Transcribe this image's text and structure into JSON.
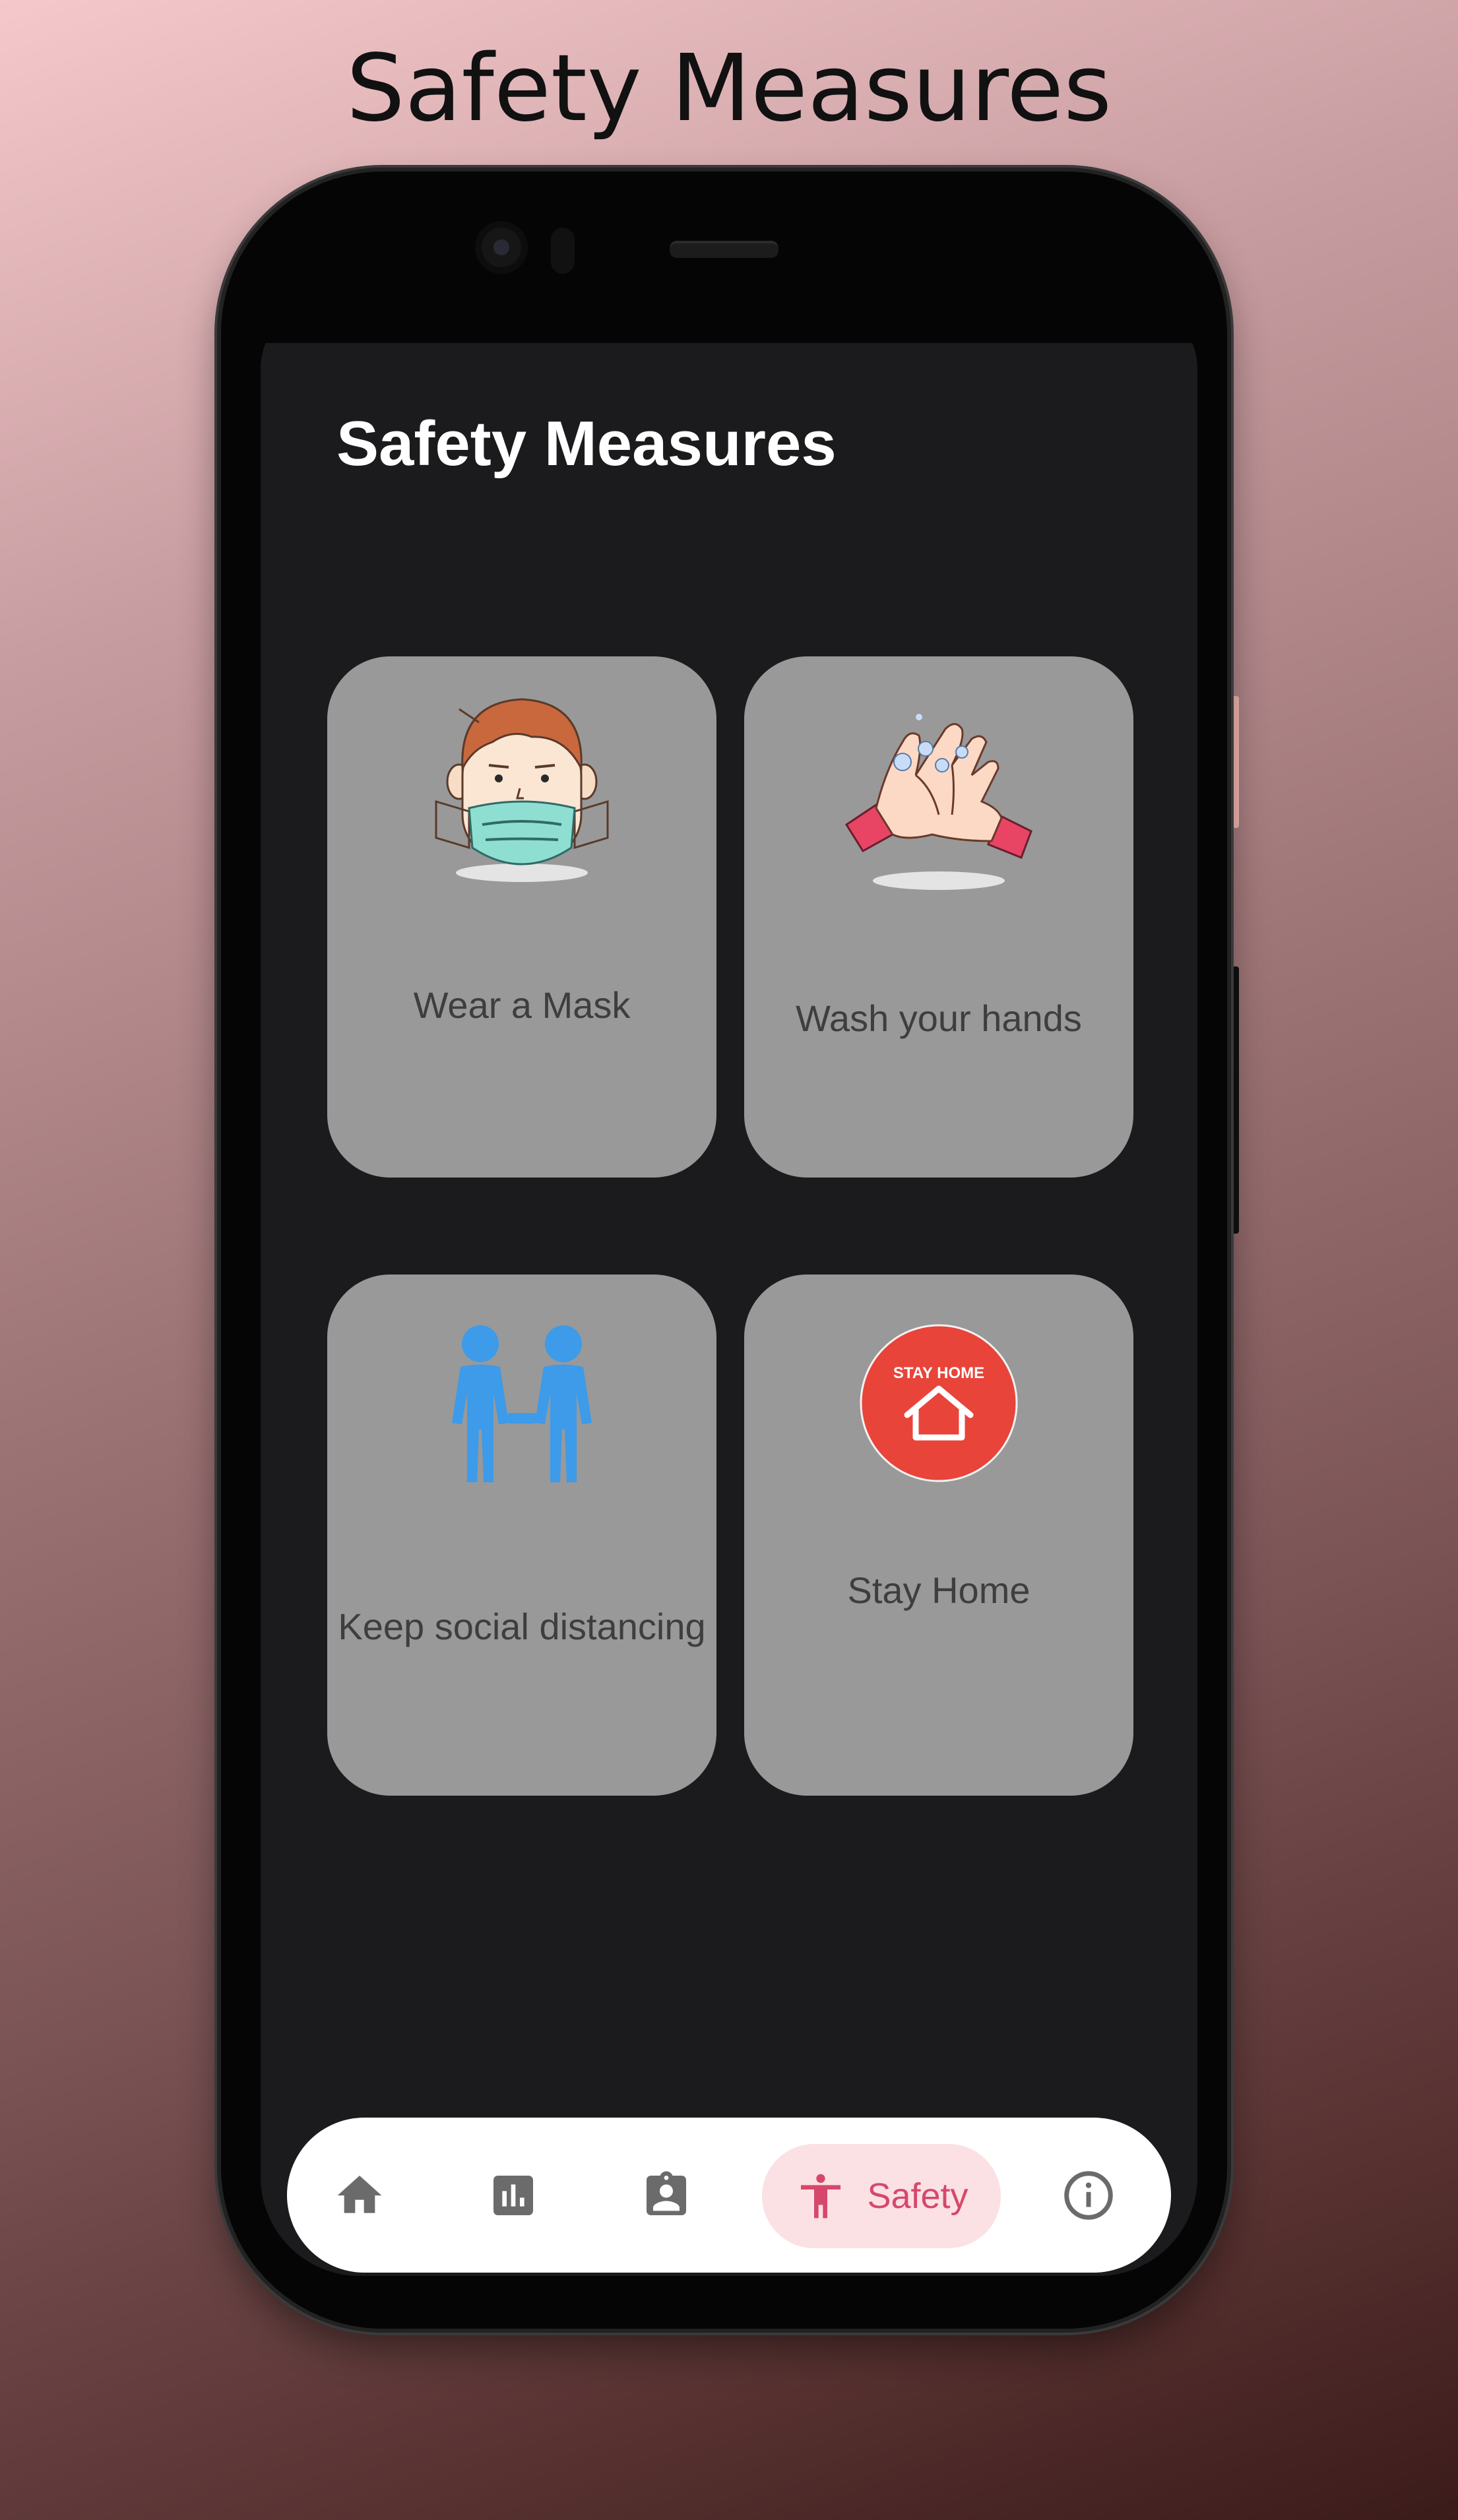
{
  "promo": {
    "title": "Safety Measures"
  },
  "app": {
    "title": "Safety Measures"
  },
  "cards": [
    {
      "label": "Wear a Mask",
      "icon": "face-mask-icon"
    },
    {
      "label": "Wash your hands",
      "icon": "washing-hands-icon"
    },
    {
      "label": "Keep social distancing",
      "icon": "social-distancing-icon"
    },
    {
      "label": "Stay Home",
      "icon": "stay-home-icon",
      "badge_text": "STAY HOME"
    }
  ],
  "bottom_nav": {
    "items": [
      {
        "icon": "home-icon"
      },
      {
        "icon": "bar-chart-icon"
      },
      {
        "icon": "contact-badge-icon"
      },
      {
        "icon": "accessibility-icon",
        "label": "Safety",
        "active": true
      },
      {
        "icon": "info-icon"
      }
    ]
  },
  "colors": {
    "screen_background": "#1b1a1c",
    "card_background": "#999999",
    "nav_active_background": "#fbe0e4",
    "nav_active_accent": "#d6486b",
    "nav_inactive_icon": "#6b6b6b",
    "stay_home_red": "#e8443a",
    "distancing_blue": "#3d9be9"
  }
}
